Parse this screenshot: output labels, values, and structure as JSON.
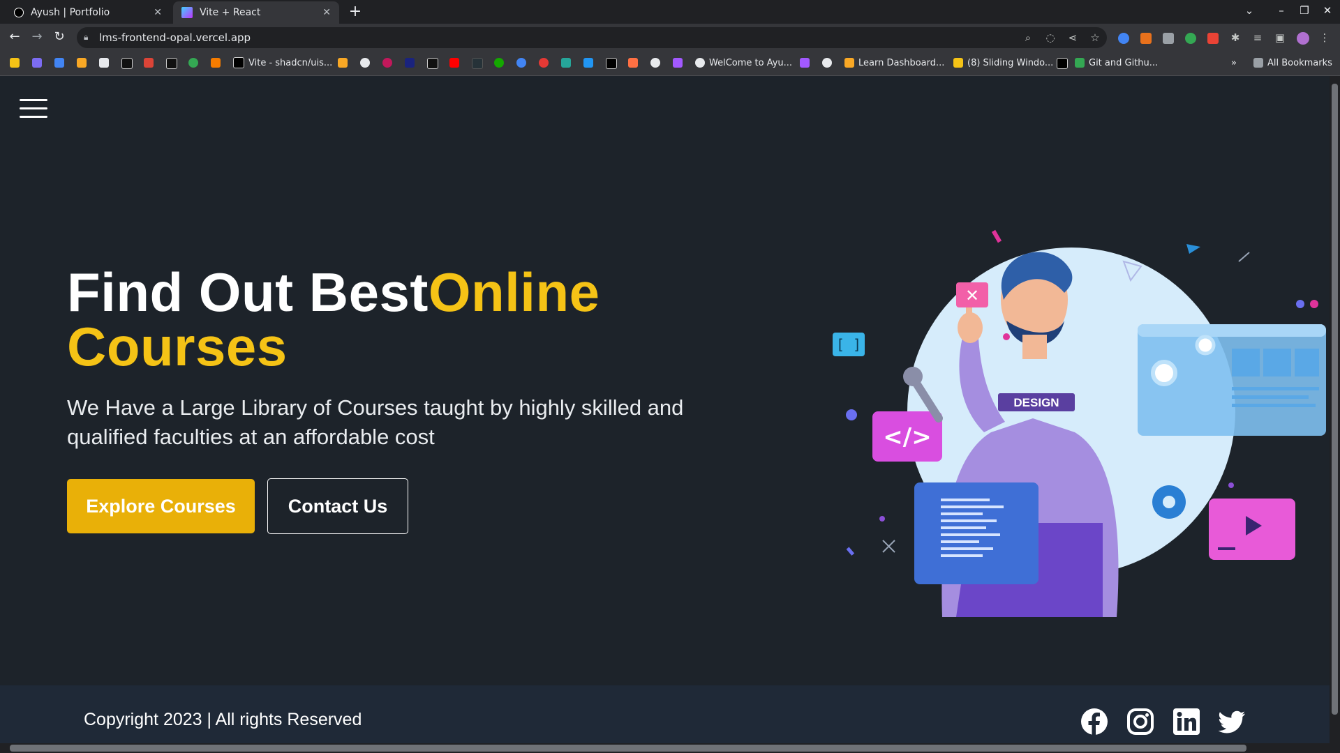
{
  "browser": {
    "tabs": [
      {
        "title": "Ayush | Portfolio",
        "active": false
      },
      {
        "title": "Vite + React",
        "active": true
      }
    ],
    "new_tab_label": "+",
    "url": "lms-frontend-opal.vercel.app",
    "bookmarks": [
      {
        "label": "Vite - shadcn/uis..."
      },
      {
        "label": "WelCome to Ayu..."
      },
      {
        "label": "Learn Dashboard..."
      },
      {
        "label": "(8) Sliding Windo..."
      },
      {
        "label": "Git and Githu..."
      }
    ],
    "all_bookmarks_label": "All Bookmarks",
    "overflow_label": "»"
  },
  "hero": {
    "heading_white": "Find Out Best",
    "heading_highlight_1": "Online",
    "heading_highlight_2": "Courses",
    "subtext": "We Have a Large Library of Courses taught by highly skilled and qualified faculties at an affordable cost",
    "explore_button": "Explore Courses",
    "contact_button": "Contact Us",
    "illustration_badge": "DESIGN"
  },
  "footer": {
    "copyright": "Copyright 2023 | All rights Reserved",
    "social_icons": [
      "facebook-icon",
      "instagram-icon",
      "linkedin-icon",
      "twitter-icon"
    ]
  },
  "colors": {
    "page_bg": "#1d232a",
    "accent_yellow": "#f5c316",
    "button_yellow": "#e9b008",
    "footer_bg": "#1f2937"
  }
}
